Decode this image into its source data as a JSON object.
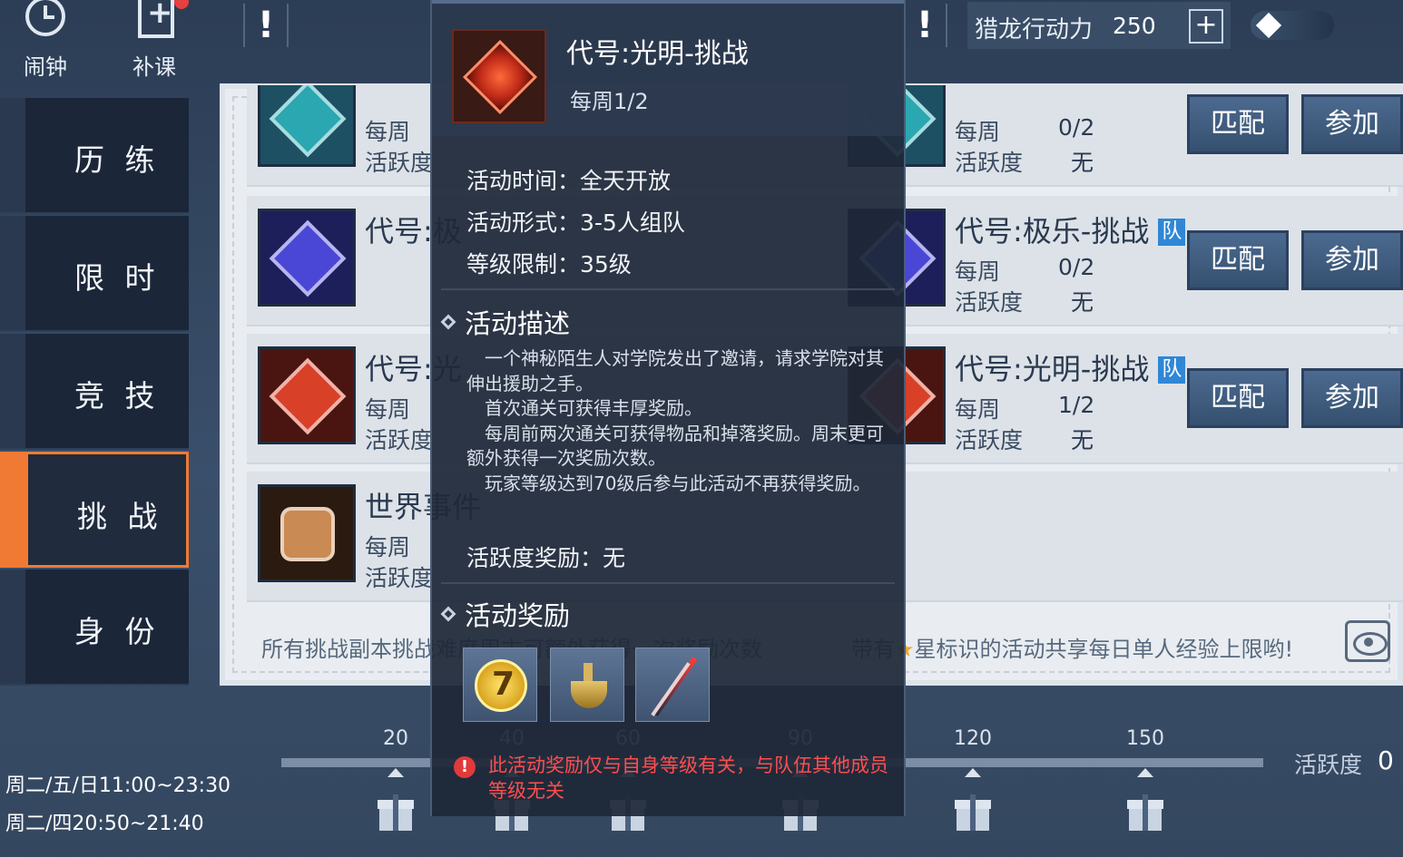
{
  "topbar": {
    "alarm_label": "闹钟",
    "makeup_label": "补课",
    "stamina_label": "猎龙行动力",
    "stamina_value": "250",
    "stamina_add": "+"
  },
  "tabs": [
    {
      "label": "历 练"
    },
    {
      "label": "限 时"
    },
    {
      "label": "竞 技"
    },
    {
      "label": "挑 战",
      "active": true
    },
    {
      "label": "身 份"
    }
  ],
  "schedule": [
    "周二/五/日11:00~23:30",
    "周二/四20:50~21:40"
  ],
  "cards": [
    {
      "title": "",
      "freq_label": "每周",
      "freq_value": "",
      "activity_label": "活跃度",
      "activity_value": "无"
    },
    {
      "title": "代号:极乐-挑战",
      "team": "队",
      "freq_label": "每周",
      "freq_value": "0/2",
      "activity_label": "活跃度",
      "activity_value": "无",
      "match": "匹配",
      "join": "参加"
    },
    {
      "title": "代号:光明-挑战",
      "team": "队",
      "freq_label": "每周",
      "freq_value": "1/2",
      "activity_label": "活跃度",
      "activity_value": "无",
      "match": "匹配",
      "join": "参加"
    },
    {
      "title": "世界事件",
      "freq_label": "每周",
      "activity_label": "活跃度"
    },
    {
      "top_freq_value": "0/2",
      "top_match": "匹配",
      "top_join": "参加"
    }
  ],
  "footnote_left": "所有挑战副本挑战难度周末可额外获得一次奖励次数",
  "footnote_right": {
    "prefix": "带有",
    "star": "★",
    "text": "星标识的活动共享每日单人经验上限哟!"
  },
  "progress": {
    "milestones": [
      "20",
      "40",
      "60",
      "90",
      "120",
      "150"
    ],
    "activity_label": "活跃度",
    "activity_value": "0"
  },
  "tooltip": {
    "title": "代号:光明-挑战",
    "freq": "每周1/2",
    "time": "活动时间：全天开放",
    "form": "活动形式：3-5人组队",
    "level": "等级限制：35级",
    "desc_heading": "活动描述",
    "desc": [
      "一个神秘陌生人对学院发出了邀请，请求学院对其伸出援助之手。",
      "首次通关可获得丰厚奖励。",
      "每周前两次通关可获得物品和掉落奖励。周末更可额外获得一次奖励次数。",
      "玩家等级达到70级后参与此活动不再获得奖励。"
    ],
    "activity_reward": "活跃度奖励：无",
    "reward_heading": "活动奖励",
    "rewards": [
      "coin-icon",
      "potion-icon",
      "sword-icon"
    ],
    "warning": "此活动奖励仅与自身等级有关，与队伍其他成员等级无关"
  },
  "colors": {
    "accent": "#f07a33",
    "team_badge": "#2f87d6",
    "warning": "#ff4d4d"
  }
}
